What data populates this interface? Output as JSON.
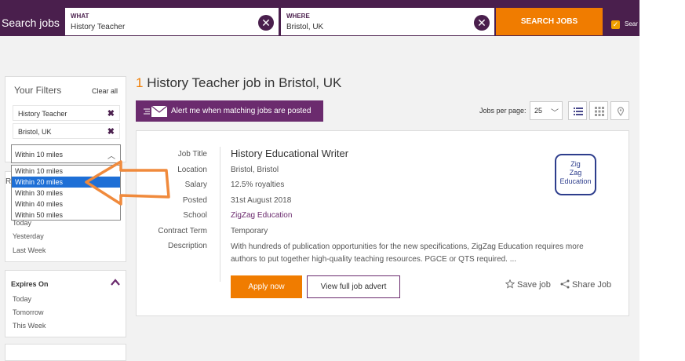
{
  "header": {
    "title": "Search jobs",
    "what_label": "WHAT",
    "what_value": "History Teacher",
    "where_label": "WHERE",
    "where_value": "Bristol, UK",
    "search_button": "SEARCH JOBS",
    "save_search_label": "Sear"
  },
  "filters": {
    "title": "Your Filters",
    "clear_all": "Clear all",
    "chips": [
      "History Teacher",
      "Bristol, UK"
    ],
    "distance_selected": "Within 10 miles",
    "distance_options": [
      "Within 10 miles",
      "Within 20 miles",
      "Within 30 miles",
      "Within 40 miles",
      "Within 50 miles"
    ],
    "highlighted_option_index": 1
  },
  "posted": {
    "stub": "R",
    "links": [
      "Today",
      "Yesterday",
      "Last Week"
    ]
  },
  "expires": {
    "title": "Expires On",
    "links": [
      "Today",
      "Tomorrow",
      "This Week"
    ]
  },
  "results": {
    "count": "1",
    "title_rest": "History Teacher job in Bristol, UK",
    "alert_button": "Alert me when matching jobs are posted",
    "jobs_per_page_label": "Jobs per page:",
    "jobs_per_page_value": "25"
  },
  "job": {
    "labels": {
      "title": "Job Title",
      "location": "Location",
      "salary": "Salary",
      "posted": "Posted",
      "school": "School",
      "contract": "Contract Term",
      "description": "Description"
    },
    "title": "History Educational Writer",
    "location": "Bristol, Bristol",
    "salary": "12.5% royalties",
    "posted": "31st August 2018",
    "school": "ZigZag Education",
    "contract": "Temporary",
    "description": "With hundreds of publication opportunities for the new specifications, ZigZag Education requires more authors to put together high-quality teaching resources. PGCE or QTS required. ...",
    "logo_lines": [
      "Zig",
      "Zag",
      "Education"
    ],
    "apply_button": "Apply now",
    "view_button": "View full job advert",
    "save_label": "Save job",
    "share_label": "Share Job"
  },
  "colors": {
    "brand_purple": "#4a1f4d",
    "accent_orange": "#f07c00",
    "selection_blue": "#1e6fd6",
    "annotation_arrow": "#f08a3c"
  }
}
